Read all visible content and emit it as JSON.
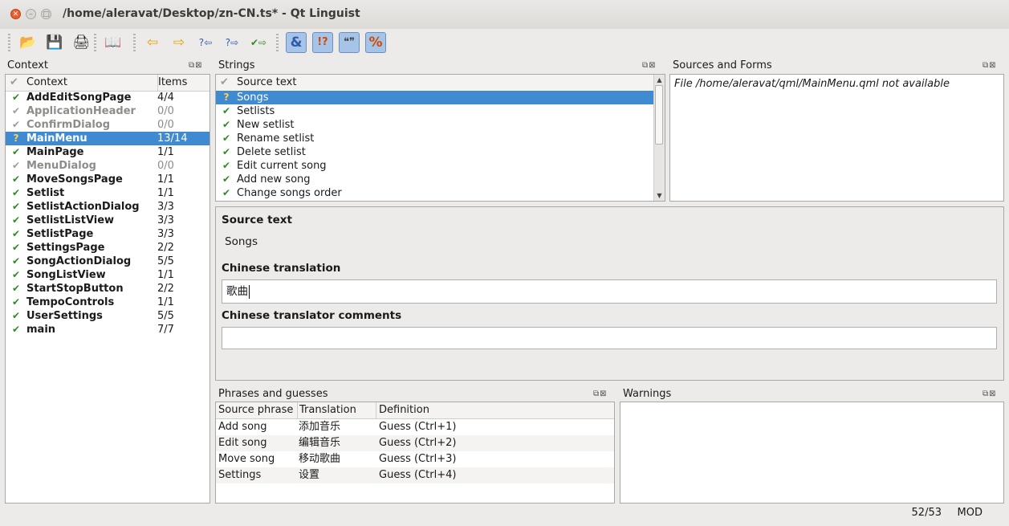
{
  "window": {
    "title": "/home/aleravat/Desktop/zn-CN.ts* - Qt Linguist"
  },
  "toolbar": {
    "buttons": [
      {
        "icon": "open-icon",
        "glyph": "📂"
      },
      {
        "icon": "save-icon",
        "glyph": "💾"
      },
      {
        "icon": "print-icon",
        "glyph": "🖨"
      },
      {
        "icon": "phrasebook-icon",
        "glyph": "📖"
      },
      {
        "icon": "prev-icon",
        "glyph": "⇦"
      },
      {
        "icon": "next-icon",
        "glyph": "⇨"
      },
      {
        "icon": "prev-unfinished-icon",
        "glyph": "?⇦"
      },
      {
        "icon": "next-unfinished-icon",
        "glyph": "?⇨"
      },
      {
        "icon": "done-next-icon",
        "glyph": "✔⇨"
      },
      {
        "icon": "accelerators-validation-icon",
        "glyph": "&"
      },
      {
        "icon": "punctuation-validation-icon",
        "glyph": "!?"
      },
      {
        "icon": "phrase-validation-icon",
        "glyph": "❝❞"
      },
      {
        "icon": "placemarker-validation-icon",
        "glyph": "%"
      }
    ]
  },
  "context": {
    "dock_title": "Context",
    "col_context": "Context",
    "col_items": "Items",
    "rows": [
      {
        "name": "AddEditSongPage",
        "items": "4/4",
        "state": "done"
      },
      {
        "name": "ApplicationHeader",
        "items": "0/0",
        "state": "empty"
      },
      {
        "name": "ConfirmDialog",
        "items": "0/0",
        "state": "empty"
      },
      {
        "name": "MainMenu",
        "items": "13/14",
        "state": "partial",
        "selected": true
      },
      {
        "name": "MainPage",
        "items": "1/1",
        "state": "done"
      },
      {
        "name": "MenuDialog",
        "items": "0/0",
        "state": "empty"
      },
      {
        "name": "MoveSongsPage",
        "items": "1/1",
        "state": "done"
      },
      {
        "name": "Setlist",
        "items": "1/1",
        "state": "done"
      },
      {
        "name": "SetlistActionDialog",
        "items": "3/3",
        "state": "done"
      },
      {
        "name": "SetlistListView",
        "items": "3/3",
        "state": "done"
      },
      {
        "name": "SetlistPage",
        "items": "3/3",
        "state": "done"
      },
      {
        "name": "SettingsPage",
        "items": "2/2",
        "state": "done"
      },
      {
        "name": "SongActionDialog",
        "items": "5/5",
        "state": "done"
      },
      {
        "name": "SongListView",
        "items": "1/1",
        "state": "done"
      },
      {
        "name": "StartStopButton",
        "items": "2/2",
        "state": "done"
      },
      {
        "name": "TempoControls",
        "items": "1/1",
        "state": "done"
      },
      {
        "name": "UserSettings",
        "items": "5/5",
        "state": "done"
      },
      {
        "name": "main",
        "items": "7/7",
        "state": "done"
      }
    ]
  },
  "strings": {
    "dock_title": "Strings",
    "col_source": "Source text",
    "rows": [
      {
        "text": "Songs",
        "state": "partial",
        "selected": true
      },
      {
        "text": "Setlists",
        "state": "done"
      },
      {
        "text": "New setlist",
        "state": "done"
      },
      {
        "text": "Rename setlist",
        "state": "done"
      },
      {
        "text": "Delete setlist",
        "state": "done"
      },
      {
        "text": "Edit current song",
        "state": "done"
      },
      {
        "text": "Add new song",
        "state": "done"
      },
      {
        "text": "Change songs order",
        "state": "done"
      }
    ]
  },
  "sources": {
    "dock_title": "Sources and Forms",
    "message": "File /home/aleravat/qml/MainMenu.qml not available"
  },
  "editor": {
    "source_label": "Source text",
    "source_value": "Songs",
    "translation_label": "Chinese translation",
    "translation_value": "歌曲",
    "comments_label": "Chinese translator comments",
    "comments_value": ""
  },
  "phrases": {
    "dock_title": "Phrases and guesses",
    "col_source": "Source phrase",
    "col_translation": "Translation",
    "col_definition": "Definition",
    "rows": [
      {
        "source": "Add song",
        "translation": "添加音乐",
        "definition": "Guess (Ctrl+1)"
      },
      {
        "source": "Edit song",
        "translation": "编辑音乐",
        "definition": "Guess (Ctrl+2)"
      },
      {
        "source": "Move song",
        "translation": "移动歌曲",
        "definition": "Guess (Ctrl+3)"
      },
      {
        "source": "Settings",
        "translation": "设置",
        "definition": "Guess (Ctrl+4)"
      }
    ]
  },
  "warnings": {
    "dock_title": "Warnings"
  },
  "status": {
    "count": "52/53",
    "mode": "MOD"
  },
  "glyphs": {
    "done": "✔",
    "empty": "✔",
    "partial": "?",
    "header_check": "✔",
    "dock_buttons": "⧉⊠"
  },
  "colors": {
    "selection": "#3f8ad1",
    "done_check": "#2e8b26",
    "partial_mark": "#c8a200"
  }
}
